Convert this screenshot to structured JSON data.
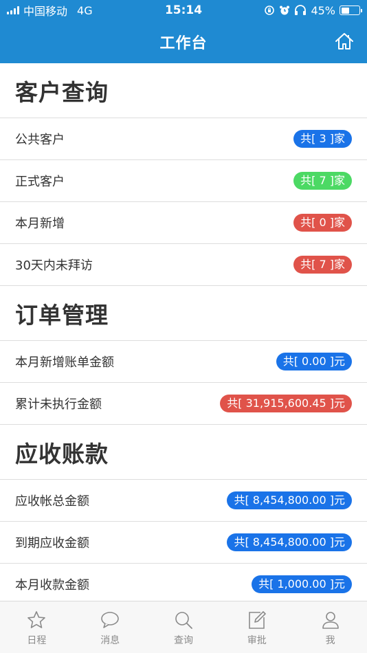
{
  "status_bar": {
    "carrier": "中国移动",
    "network": "4G",
    "time": "15:14",
    "battery": "45%",
    "battery_level": 0.45
  },
  "header": {
    "title": "工作台",
    "home_icon": "home-icon"
  },
  "sections": [
    {
      "title": "客户查询",
      "rows": [
        {
          "label": "公共客户",
          "badge": "共[ 3 ]家",
          "color": "#1a73e8"
        },
        {
          "label": "正式客户",
          "badge": "共[ 7 ]家",
          "color": "#4cd964"
        },
        {
          "label": "本月新增",
          "badge": "共[ 0 ]家",
          "color": "#e0534a"
        },
        {
          "label": "30天内未拜访",
          "badge": "共[ 7 ]家",
          "color": "#e0534a"
        }
      ]
    },
    {
      "title": "订单管理",
      "rows": [
        {
          "label": "本月新增账单金额",
          "badge": "共[ 0.00 ]元",
          "color": "#1a73e8"
        },
        {
          "label": "累计未执行金额",
          "badge": "共[ 31,915,600.45 ]元",
          "color": "#e0534a"
        }
      ]
    },
    {
      "title": "应收账款",
      "rows": [
        {
          "label": "应收帐总金额",
          "badge": "共[ 8,454,800.00 ]元",
          "color": "#1a73e8"
        },
        {
          "label": "到期应收金额",
          "badge": "共[ 8,454,800.00 ]元",
          "color": "#1a73e8"
        },
        {
          "label": "本月收款金额",
          "badge": "共[ 1,000.00 ]元",
          "color": "#1a73e8"
        }
      ]
    }
  ],
  "tabbar": [
    {
      "label": "日程",
      "icon": "star-icon"
    },
    {
      "label": "消息",
      "icon": "chat-bubble-icon"
    },
    {
      "label": "查询",
      "icon": "search-icon"
    },
    {
      "label": "审批",
      "icon": "edit-icon"
    },
    {
      "label": "我",
      "icon": "user-icon"
    }
  ],
  "colors": {
    "brand": "#1f8ad2",
    "badge_blue": "#1a73e8",
    "badge_green": "#4cd964",
    "badge_red": "#e0534a"
  }
}
